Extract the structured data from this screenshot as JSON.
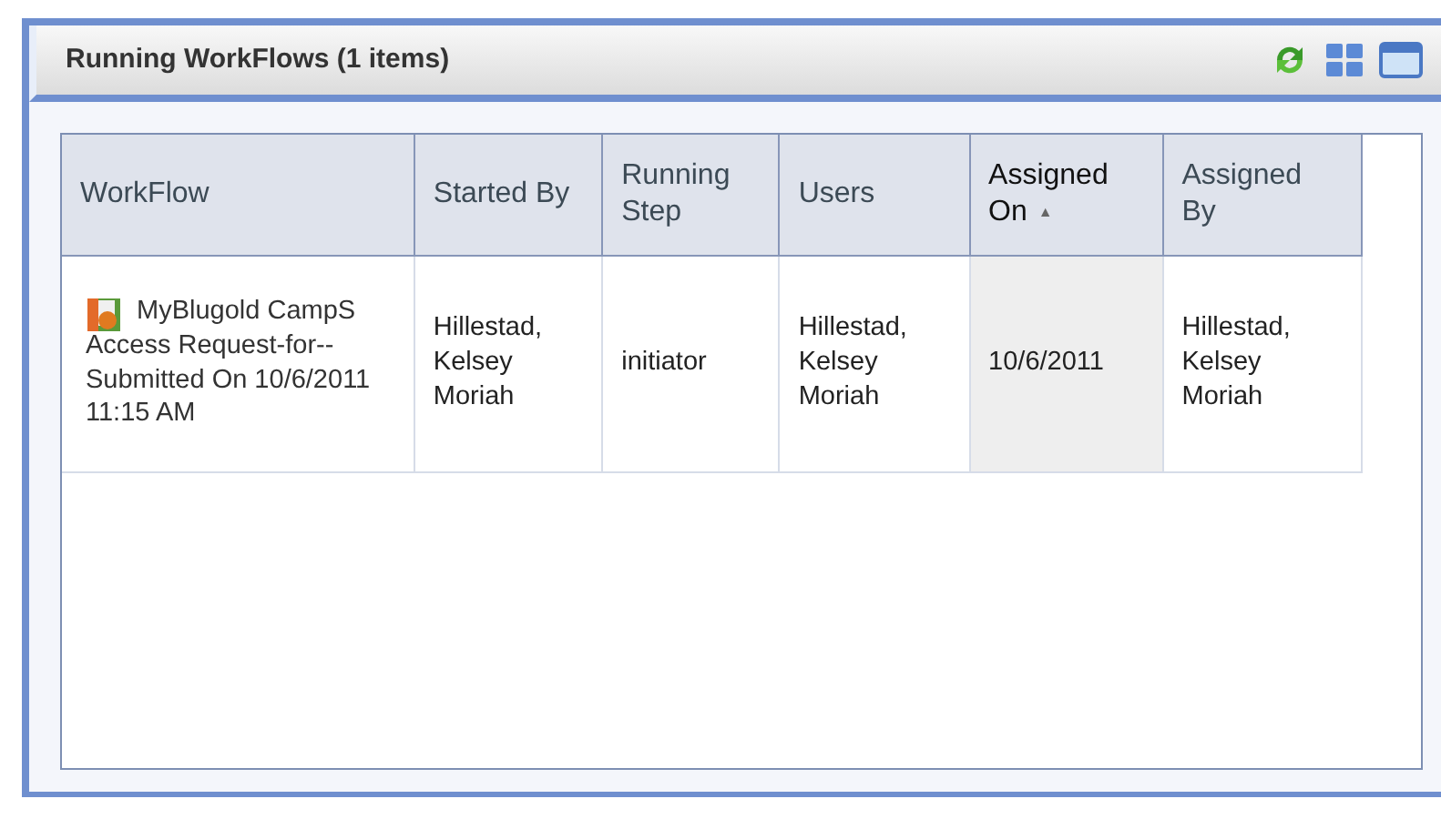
{
  "panel": {
    "title": "Running WorkFlows (1 items)"
  },
  "table": {
    "columns": [
      {
        "label": "WorkFlow",
        "sorted": false
      },
      {
        "label": "Started By",
        "sorted": false
      },
      {
        "label": "Running Step",
        "sorted": false
      },
      {
        "label": "Users",
        "sorted": false
      },
      {
        "label": "Assigned On",
        "sorted": true,
        "sort_arrow": "▲"
      },
      {
        "label": "Assigned By",
        "sorted": false
      }
    ],
    "rows": [
      {
        "cells": [
          "MyBlugold CampS Access Request-for--Submitted On 10/6/2011 11:15 AM",
          "Hillestad, Kelsey Moriah",
          "initiator",
          "Hillestad, Kelsey Moriah",
          "10/6/2011",
          "Hillestad, Kelsey Moriah"
        ]
      }
    ]
  }
}
